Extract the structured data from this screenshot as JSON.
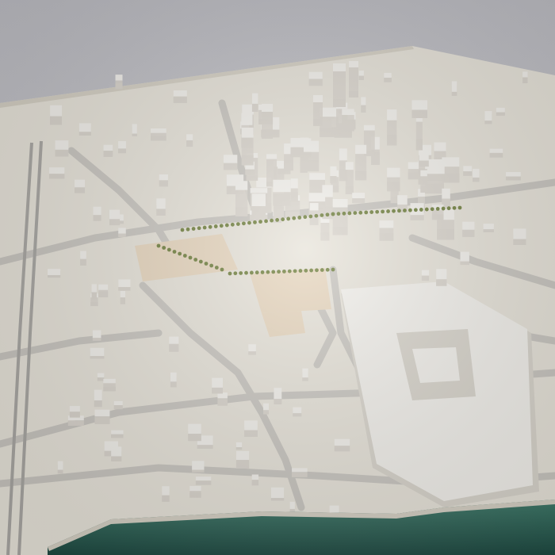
{
  "scene": {
    "subject": "architectural-urban-massing-model",
    "colors": {
      "sky": "#cfcfd3",
      "sky_top": "#bdbdc3",
      "base": "#e8e4da",
      "base_edge": "#d5d0c4",
      "road": "#c9c6c0",
      "building": "#f3f1ec",
      "building_side": "#d9d5cc",
      "plaza": "#e8d7bf",
      "trees": "#6f7f3c",
      "water": "#3f7a6a",
      "water_dark": "#1f4a42",
      "rail": "#a9a7a3"
    }
  }
}
